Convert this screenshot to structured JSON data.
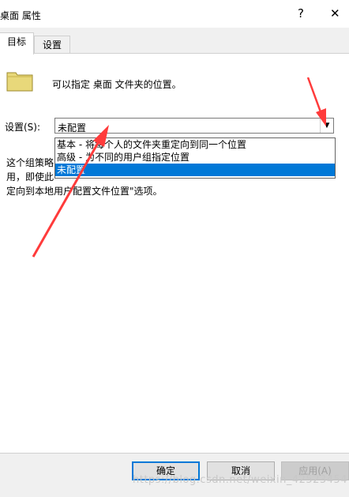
{
  "window": {
    "title": "桌面 属性",
    "help_glyph": "?",
    "close_glyph": "✕"
  },
  "tabs": [
    {
      "label": "目标"
    },
    {
      "label": "设置"
    }
  ],
  "target_tab": {
    "description": "可以指定 桌面 文件夹的位置。",
    "setting_label": "设置(S):",
    "combo_value": "未配置",
    "dropdown_options": [
      "基本 - 将每个人的文件夹重定向到同一个位置",
      "高级 - 为不同的用户组指定位置",
      "未配置"
    ],
    "explanation_lines": [
      "这个组策略",
      "用，即使此",
      "定向到本地用户配置文件位置\"选项。"
    ]
  },
  "buttons": {
    "ok": "确定",
    "cancel": "取消",
    "apply": "应用(A)"
  },
  "watermark": "https://blog.csdn.net/weixin_42523454",
  "colors": {
    "selection": "#0078d7",
    "folder": "#e8d87a",
    "annotation_arrow": "#ff3b3b"
  }
}
